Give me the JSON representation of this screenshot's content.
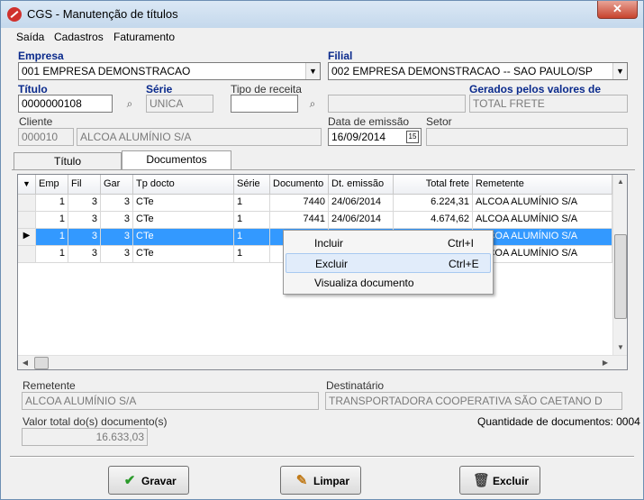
{
  "window": {
    "title": "CGS - Manutenção de títulos",
    "close_glyph": "✕"
  },
  "menu": [
    "Saída",
    "Cadastros",
    "Faturamento"
  ],
  "form": {
    "empresa": {
      "label": "Empresa",
      "value": "001 EMPRESA DEMONSTRACAO"
    },
    "filial": {
      "label": "Filial",
      "value": "002 EMPRESA DEMONSTRACAO -- SAO PAULO/SP"
    },
    "titulo": {
      "label": "Título",
      "value": "0000000108"
    },
    "serie": {
      "label": "Série",
      "value": "UNICA"
    },
    "tipo_receita": {
      "label": "Tipo de receita",
      "value": ""
    },
    "tipo_receita_desc": {
      "value": ""
    },
    "gerados": {
      "label": "Gerados pelos valores de",
      "value": "TOTAL FRETE"
    },
    "cliente": {
      "label": "Cliente",
      "code": "000010",
      "name": "ALCOA ALUMÍNIO S/A"
    },
    "data_emissao": {
      "label": "Data de emissão",
      "value": "16/09/2014",
      "cal": "15"
    },
    "setor": {
      "label": "Setor",
      "value": ""
    }
  },
  "tabs": [
    {
      "label": "Título",
      "active": false
    },
    {
      "label": "Documentos",
      "active": true
    }
  ],
  "grid": {
    "columns": [
      "Emp",
      "Fil",
      "Gar",
      "Tp docto",
      "Série",
      "Documento",
      "Dt. emissão",
      "Total frete",
      "Remetente"
    ],
    "rows": [
      {
        "emp": "1",
        "fil": "3",
        "gar": "3",
        "tp": "CTe",
        "serie": "1",
        "doc": "7440",
        "dt": "24/06/2014",
        "total": "6.224,31",
        "rem": "ALCOA ALUMÍNIO S/A",
        "selected": false
      },
      {
        "emp": "1",
        "fil": "3",
        "gar": "3",
        "tp": "CTe",
        "serie": "1",
        "doc": "7441",
        "dt": "24/06/2014",
        "total": "4.674,62",
        "rem": "ALCOA ALUMÍNIO S/A",
        "selected": false
      },
      {
        "emp": "1",
        "fil": "3",
        "gar": "3",
        "tp": "CTe",
        "serie": "1",
        "doc": "",
        "dt": "",
        "total": "",
        "rem": "ALCOA ALUMÍNIO S/A",
        "selected": true
      },
      {
        "emp": "1",
        "fil": "3",
        "gar": "3",
        "tp": "CTe",
        "serie": "1",
        "doc": "",
        "dt": "",
        "total": "",
        "rem": "ALCOA ALUMÍNIO S/A",
        "selected": false
      }
    ]
  },
  "context_menu": [
    {
      "label": "Incluir",
      "shortcut": "Ctrl+I"
    },
    {
      "label": "Excluir",
      "shortcut": "Ctrl+E"
    },
    {
      "label": "Visualiza documento",
      "shortcut": ""
    }
  ],
  "footer": {
    "remetente": {
      "label": "Remetente",
      "value": "ALCOA ALUMÍNIO S/A"
    },
    "destinatario": {
      "label": "Destinatário",
      "value": "TRANSPORTADORA COOPERATIVA SÃO CAETANO D"
    },
    "valor_total": {
      "label": "Valor total do(s) documento(s)",
      "value": "16.633,03"
    },
    "quantidade": "Quantidade de documentos: 0004"
  },
  "buttons": {
    "gravar": "Gravar",
    "limpar": "Limpar",
    "excluir": "Excluir"
  }
}
